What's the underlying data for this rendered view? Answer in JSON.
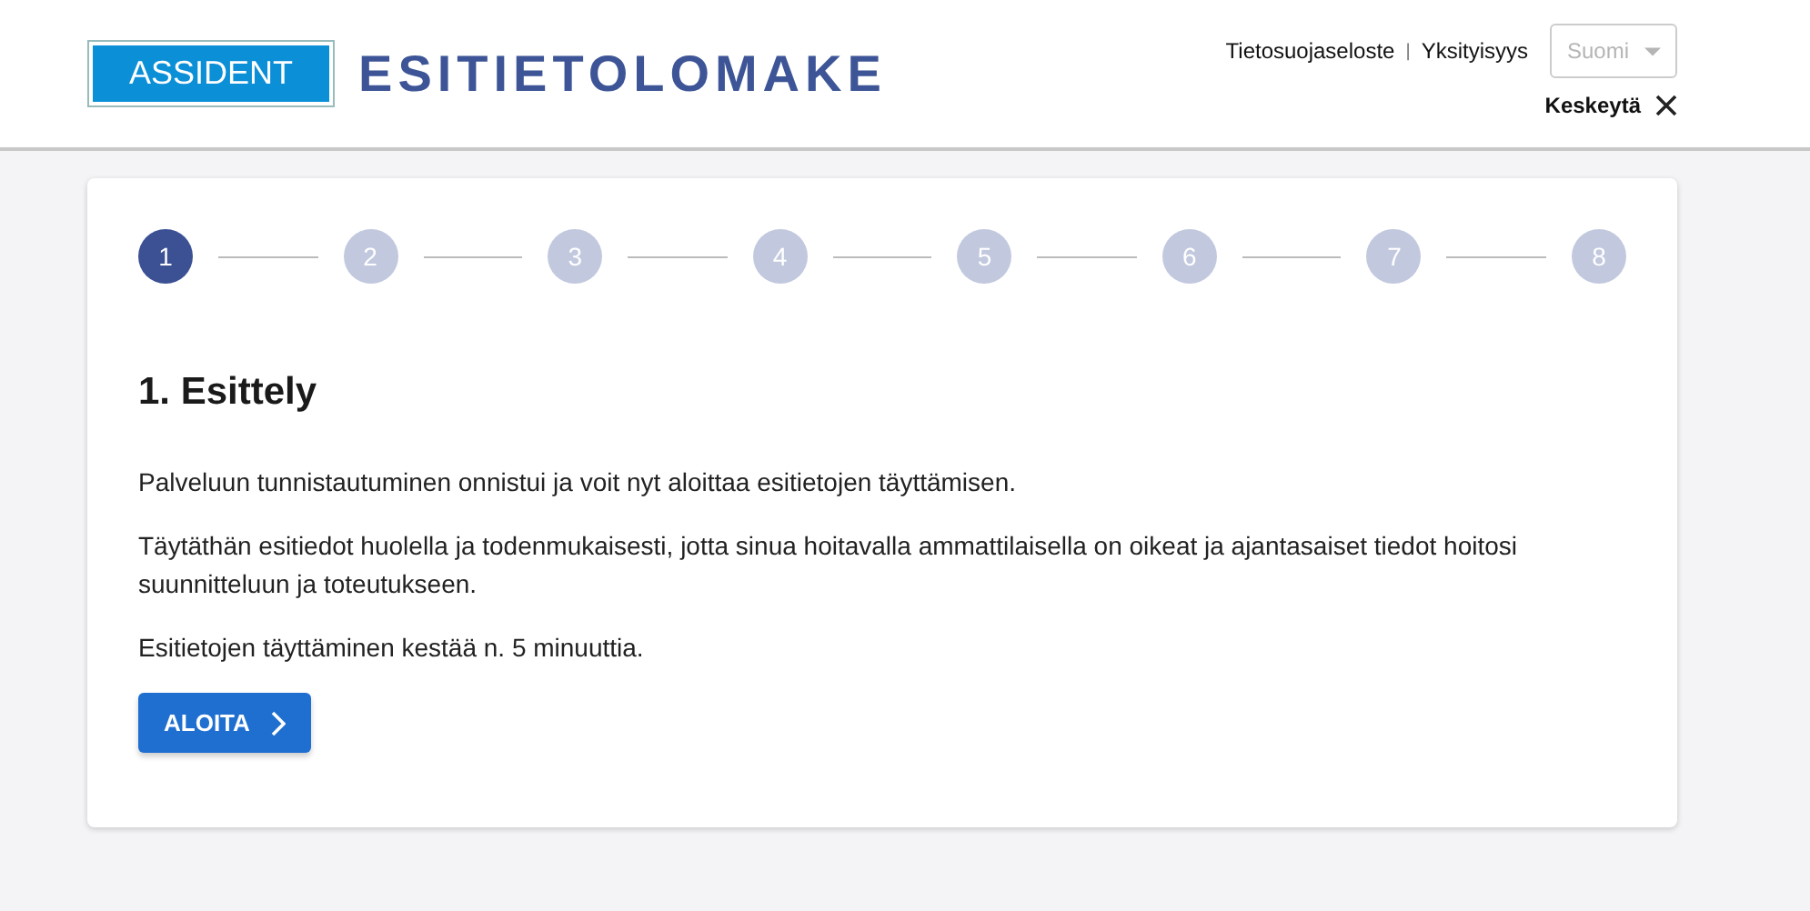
{
  "header": {
    "logo": "ASSIDENT",
    "title": "ESITIETOLOMAKE",
    "links": [
      "Tietosuojaseloste",
      "Yksityisyys"
    ],
    "separator": "|",
    "language": {
      "value": "Suomi",
      "disabled": true
    },
    "cancel": "Keskeytä"
  },
  "stepper": [
    {
      "label": "1",
      "selected": true
    },
    {
      "label": "2",
      "selected": false
    },
    {
      "label": "3",
      "selected": false
    },
    {
      "label": "4",
      "selected": false
    },
    {
      "label": "5",
      "selected": false
    },
    {
      "label": "6",
      "selected": false
    },
    {
      "label": "7",
      "selected": false
    },
    {
      "label": "8",
      "selected": false
    }
  ],
  "section": {
    "heading": "1. Esittely",
    "paragraphs": [
      "Palveluun tunnistautuminen onnistui ja voit nyt aloittaa esitietojen täyttämisen.",
      "Täytäthän esitiedot huolella ja todenmukaisesti, jotta sinua hoitavalla ammattilaisella on oikeat ja ajantasaiset tiedot hoitosi suunnitteluun ja toteutukseen.",
      "Esitietojen täyttäminen kestää n. 5 minuuttia."
    ],
    "button": "ALOITA"
  }
}
